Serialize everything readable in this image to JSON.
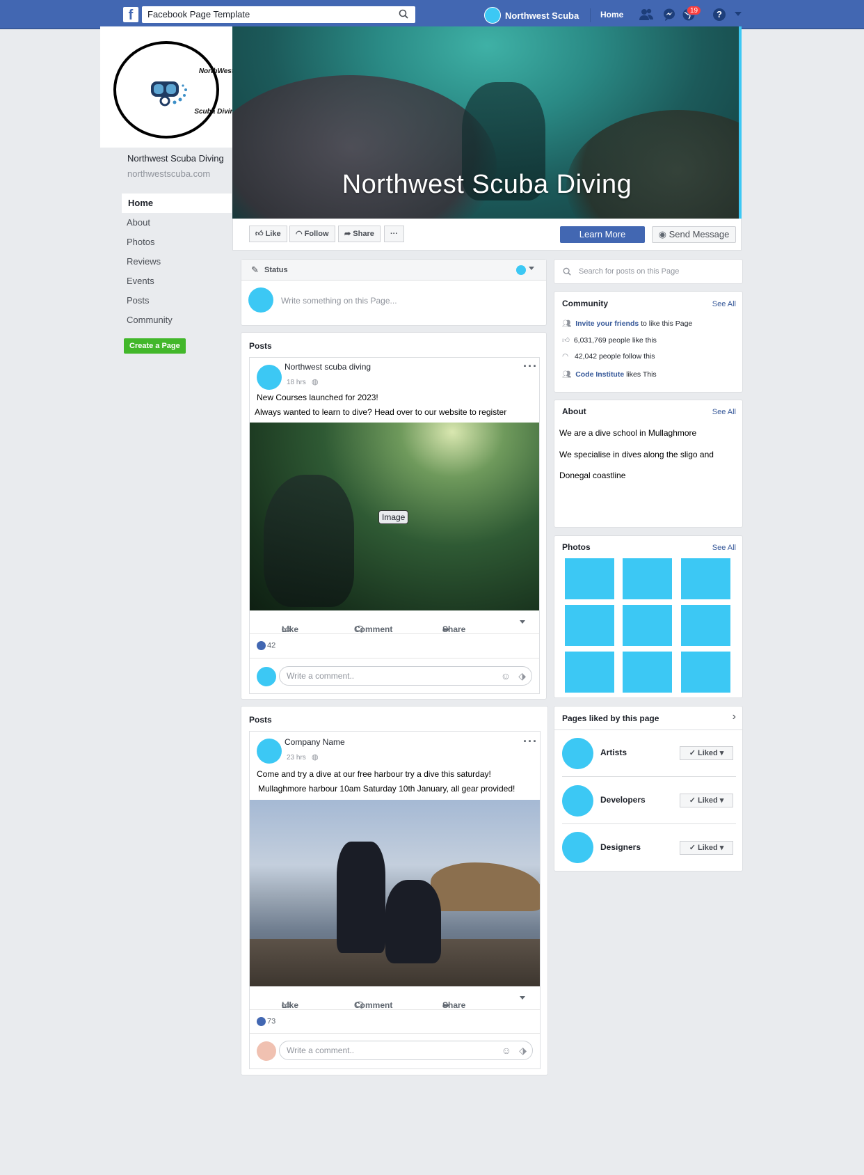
{
  "topbar": {
    "search_value": "Facebook Page Template",
    "profile_name": "Northwest Scuba",
    "home_label": "Home",
    "notification_count": "19",
    "help_label": "?"
  },
  "logo": {
    "line1": "NorthWest",
    "line2": "Scuba Diving"
  },
  "page": {
    "name": "Northwest Scuba Diving",
    "url": "northwestscuba.com"
  },
  "left_nav": [
    "Home",
    "About",
    "Photos",
    "Reviews",
    "Events",
    "Posts",
    "Community"
  ],
  "create_page_label": "Create a Page",
  "cover": {
    "title": "Northwest Scuba Diving"
  },
  "actions": {
    "like": "Like",
    "follow": "Follow",
    "share": "Share",
    "more": "···",
    "learn_more": "Learn More",
    "send_message": "Send Message"
  },
  "composer": {
    "status_label": "Status",
    "placeholder": "Write something on this Page..."
  },
  "posts": [
    {
      "section_title": "Posts",
      "author": "Northwest scuba diving",
      "time": "18 hrs",
      "line1": "New Courses launched for 2023!",
      "line2": "Always wanted to learn to dive? Head over to our website to register",
      "image_label": "Image",
      "like": "Like",
      "comment": "Comment",
      "share": "Share",
      "likes": "42",
      "comment_placeholder": "Write a comment.."
    },
    {
      "section_title": "Posts",
      "author": "Company Name",
      "time": "23 hrs",
      "line1": "Come and try a dive at our free harbour try a dive this saturday!",
      "line2": "Mullaghmore harbour 10am Saturday 10th January, all gear provided!",
      "like": "Like",
      "comment": "Comment",
      "share": "Share",
      "likes": "73",
      "comment_placeholder": "Write a comment.."
    }
  ],
  "right": {
    "search_placeholder": "Search for posts on this Page",
    "community": {
      "title": "Community",
      "see_all": "See All",
      "invite_link": "Invite your friends",
      "invite_rest": " to like this Page",
      "likes": "6,031,769 people like this",
      "follows": "42,042 people follow this",
      "ci_link": "Code Institute",
      "ci_rest": " likes This"
    },
    "about": {
      "title": "About",
      "see_all": "See All",
      "line1": "We are a dive school in  Mullaghmore",
      "line2": "We specialise in dives along the sligo and",
      "line3": "Donegal coastline"
    },
    "photos": {
      "title": "Photos",
      "see_all": "See All"
    },
    "liked_pages": {
      "title": "Pages liked by this page",
      "items": [
        {
          "name": "Artists",
          "button": "Liked"
        },
        {
          "name": "Developers",
          "button": "Liked"
        },
        {
          "name": "Designers",
          "button": "Liked"
        }
      ]
    }
  },
  "colors": {
    "brand": "#4267b2",
    "accent": "#3cc8f4",
    "create": "#42b72a"
  }
}
